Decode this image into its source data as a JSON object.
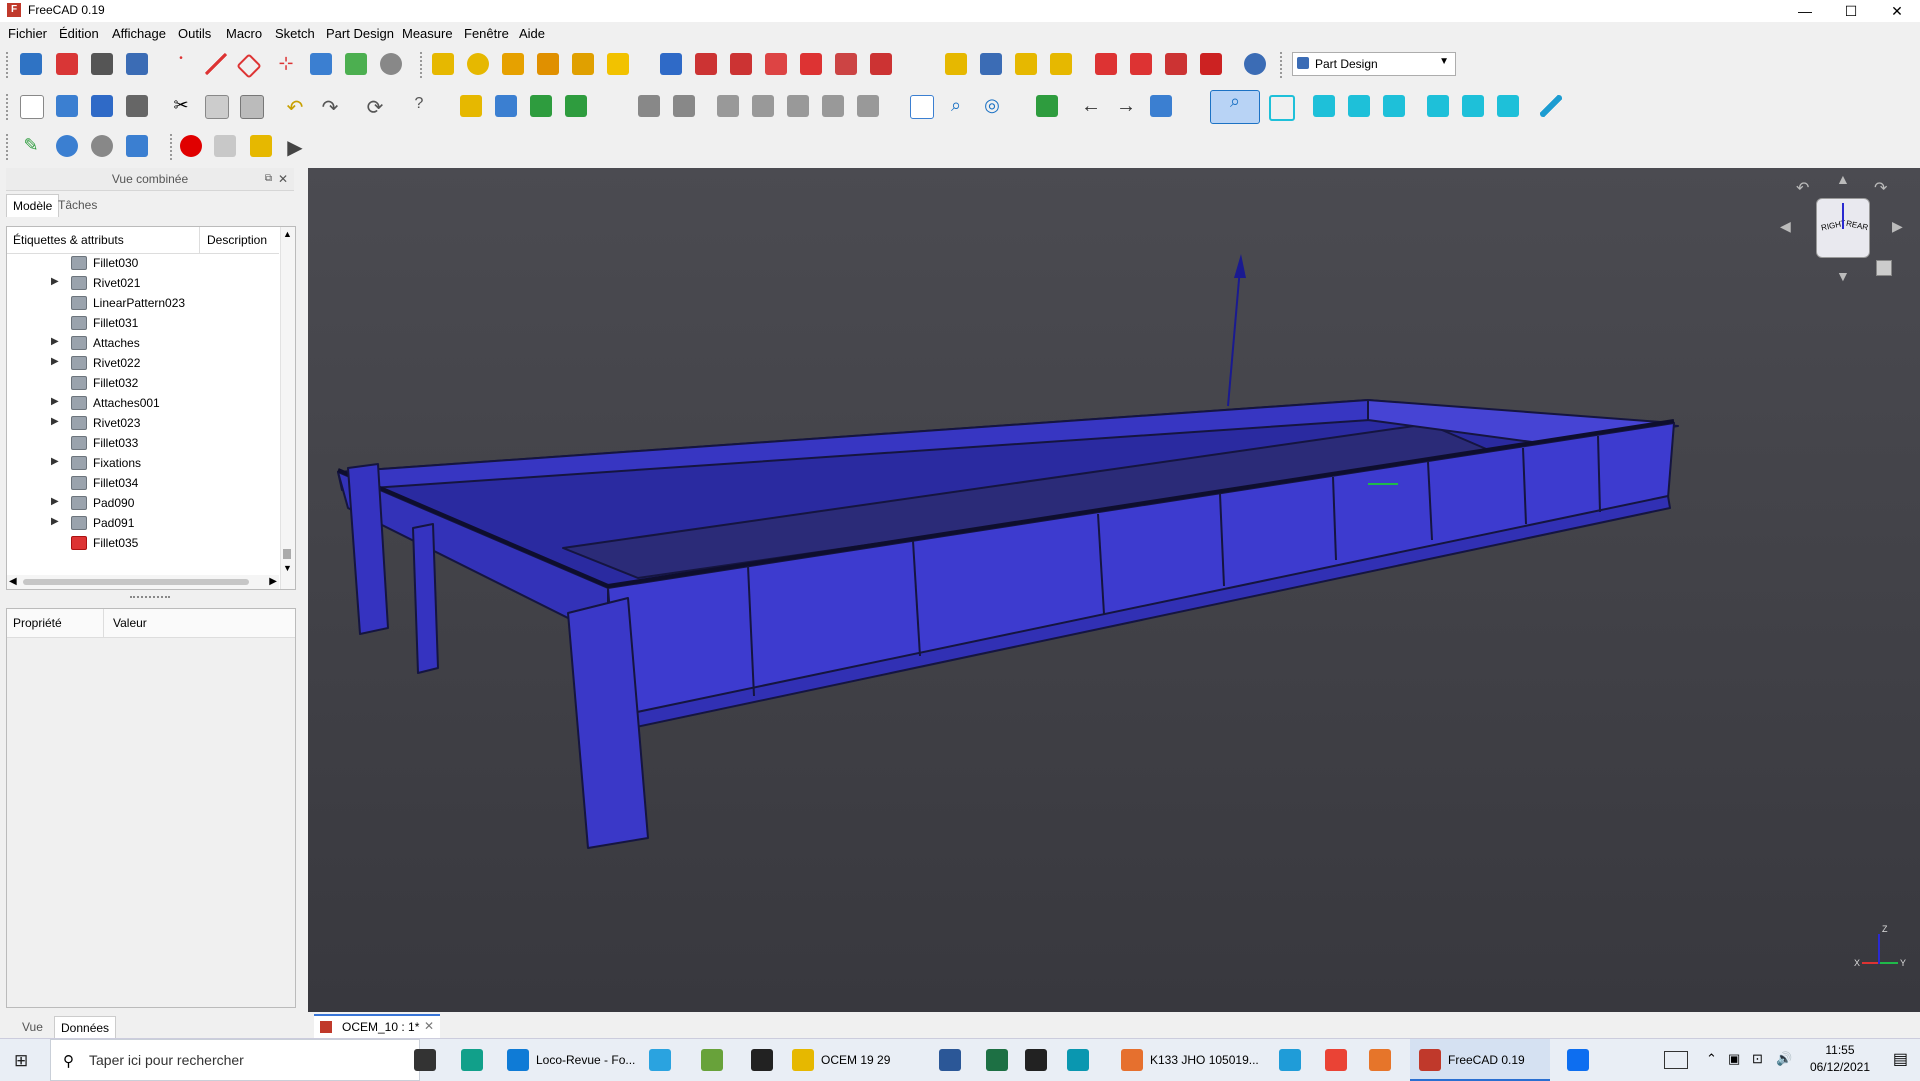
{
  "window": {
    "title": "FreeCAD 0.19",
    "app_icon": "freecad-icon"
  },
  "menu": [
    "Fichier",
    "Édition",
    "Affichage",
    "Outils",
    "Macro",
    "Sketch",
    "Part Design",
    "Measure",
    "Fenêtre",
    "Aide"
  ],
  "workbench": {
    "selected": "Part Design"
  },
  "combo_view": {
    "title": "Vue combinée",
    "tabs": [
      "Modèle",
      "Tâches"
    ],
    "active_tab": "Modèle",
    "tree_headers": [
      "Étiquettes & attributs",
      "Description"
    ],
    "tree_items": [
      {
        "label": "Fillet030",
        "expandable": false,
        "icon": "fillet-icon"
      },
      {
        "label": "Rivet021",
        "expandable": true,
        "icon": "body-icon"
      },
      {
        "label": "LinearPattern023",
        "expandable": false,
        "icon": "linear-pattern-icon"
      },
      {
        "label": "Fillet031",
        "expandable": false,
        "icon": "fillet-icon"
      },
      {
        "label": "Attaches",
        "expandable": true,
        "icon": "body-icon"
      },
      {
        "label": "Rivet022",
        "expandable": true,
        "icon": "body-icon"
      },
      {
        "label": "Fillet032",
        "expandable": false,
        "icon": "fillet-icon"
      },
      {
        "label": "Attaches001",
        "expandable": true,
        "icon": "body-icon"
      },
      {
        "label": "Rivet023",
        "expandable": true,
        "icon": "body-icon"
      },
      {
        "label": "Fillet033",
        "expandable": false,
        "icon": "fillet-icon"
      },
      {
        "label": "Fixations",
        "expandable": true,
        "icon": "body-icon"
      },
      {
        "label": "Fillet034",
        "expandable": false,
        "icon": "fillet-icon"
      },
      {
        "label": "Pad090",
        "expandable": true,
        "icon": "pad-icon"
      },
      {
        "label": "Pad091",
        "expandable": true,
        "icon": "pad-icon"
      },
      {
        "label": "Fillet035",
        "expandable": false,
        "icon": "fillet-tip-icon"
      }
    ],
    "property_headers": [
      "Propriété",
      "Valeur"
    ],
    "bottom_tabs": [
      "Vue",
      "Données"
    ],
    "active_bottom_tab": "Données"
  },
  "navigation_cube": {
    "faces": [
      "RIGHT",
      "REAR"
    ]
  },
  "axis_labels": [
    "Z",
    "X",
    "Y"
  ],
  "document_tab": {
    "label": "OCEM_10 : 1*"
  },
  "taskbar": {
    "search_placeholder": "Taper ici pour rechercher",
    "apps": [
      {
        "label": "",
        "icon": "task-view-icon"
      },
      {
        "label": "",
        "icon": "xmind-icon"
      },
      {
        "label": "Loco-Revue - Fo...",
        "icon": "edge-icon"
      },
      {
        "label": "",
        "icon": "telegram-icon"
      },
      {
        "label": "",
        "icon": "notepad-icon"
      },
      {
        "label": "",
        "icon": "7zip-icon"
      },
      {
        "label": "OCEM 19 29",
        "icon": "folder-icon"
      },
      {
        "label": "",
        "icon": "word-icon"
      },
      {
        "label": "",
        "icon": "excel-icon"
      },
      {
        "label": "",
        "icon": "inkscape-icon"
      },
      {
        "label": "",
        "icon": "arduino-icon"
      },
      {
        "label": "K133 JHO 105019...",
        "icon": "image-viewer-icon"
      },
      {
        "label": "",
        "icon": "skype-icon"
      },
      {
        "label": "",
        "icon": "chrome-icon"
      },
      {
        "label": "",
        "icon": "foxit-icon"
      },
      {
        "label": "FreeCAD 0.19",
        "icon": "freecad-icon"
      },
      {
        "label": "",
        "icon": "dropbox-icon"
      }
    ],
    "time": "11:55",
    "date": "06/12/2021"
  },
  "colors": {
    "model_fill": "#3d3bcf",
    "model_edge": "#151540",
    "viewport_top": "#4b4b51",
    "viewport_bottom": "#38383e",
    "highlight": "#1c72c4"
  }
}
